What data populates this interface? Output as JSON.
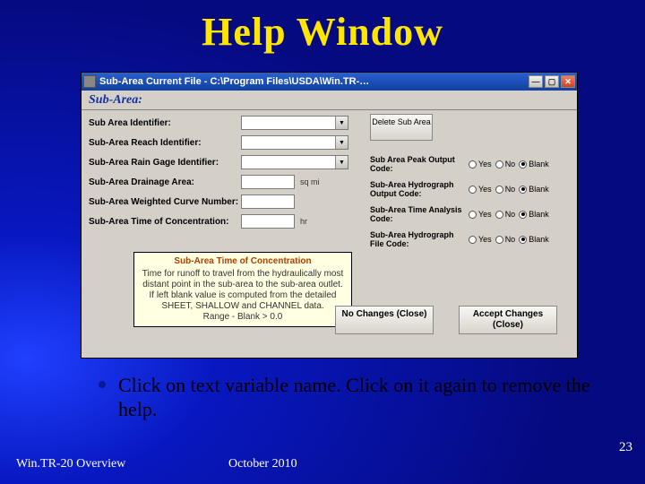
{
  "slide": {
    "title": "Help Window",
    "bullet": "Click on text variable name.  Click on it again to remove the help.",
    "footer_left": "Win.TR-20 Overview",
    "footer_mid": "October 2010",
    "page_number": "23"
  },
  "win": {
    "title": "Sub-Area   Current File - C:\\Program Files\\USDA\\Win.TR-…",
    "subheader": "Sub-Area:",
    "delete_btn": "Delete Sub Area",
    "fields": {
      "identifier": "Sub Area Identifier:",
      "reach": "Sub-Area Reach Identifier:",
      "raingage": "Sub-Area Rain Gage Identifier:",
      "drainage": "Sub-Area Drainage Area:",
      "drainage_unit": "sq mi",
      "curve": "Sub-Area Weighted Curve Number:",
      "toc": "Sub-Area Time of Concentration:",
      "toc_unit": "hr"
    },
    "right": {
      "peak": "Sub Area Peak Output Code:",
      "hydro": "Sub-Area Hydrograph Output Code:",
      "time": "Sub-Area Time Analysis Code:",
      "file": "Sub-Area Hydrograph File Code:",
      "yes": "Yes",
      "no": "No",
      "blank": "Blank"
    },
    "tooltip": {
      "title": "Sub-Area Time of Concentration",
      "body": "Time for runoff to travel from the hydraulically most distant point in the sub-area to the sub-area outlet. If left blank value is computed from the detailed SHEET, SHALLOW and CHANNEL data.",
      "range": "Range - Blank > 0.0"
    },
    "buttons": {
      "no_changes": "No Changes (Close)",
      "accept": "Accept Changes (Close)"
    }
  }
}
